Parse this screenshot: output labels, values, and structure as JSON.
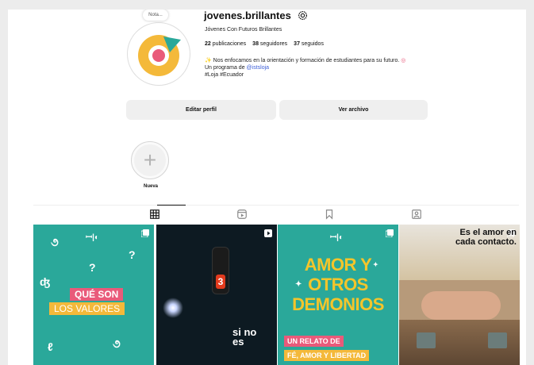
{
  "profile": {
    "username": "jovenes.brillantes",
    "fullname": "Jóvenes Con Futuros Brillantes",
    "note": "Nota...",
    "stats": {
      "posts_count": "22",
      "posts_label": "publicaciones",
      "followers_count": "38",
      "followers_label": "seguidores",
      "following_count": "37",
      "following_label": "seguidos"
    },
    "bio": {
      "line1": "Nos enfocamos en la orientación y formación de estudiantes para su futuro.",
      "line2_prefix": "Un programa de ",
      "line2_link": "@istsloja",
      "line3": "#Loja #Ecuador"
    }
  },
  "buttons": {
    "edit": "Editar perfil",
    "archive": "Ver archivo"
  },
  "highlight": {
    "label": "Nueva"
  },
  "tabs": [
    {
      "name": "posts-grid",
      "icon": "grid-icon"
    },
    {
      "name": "reels",
      "icon": "reels-icon"
    },
    {
      "name": "saved",
      "icon": "bookmark-icon"
    },
    {
      "name": "tagged",
      "icon": "tagged-icon"
    }
  ],
  "posts": [
    {
      "line1": "QUÉ SON",
      "line2": "LOS VALORES"
    },
    {
      "text_line1": "si no",
      "text_line2": "es"
    },
    {
      "line1": "AMOR Y",
      "line2": "OTROS",
      "line3": "DEMONIOS",
      "tag1": "UN RELATO DE",
      "tag2": "FÉ, AMOR Y LIBERTAD"
    },
    {
      "line1": "Es el amor en",
      "line2": "cada contacto."
    }
  ],
  "colors": {
    "teal": "#2aa89a",
    "pink": "#e95a7a",
    "yellow": "#f4b93a",
    "link": "#3d5fd8"
  }
}
